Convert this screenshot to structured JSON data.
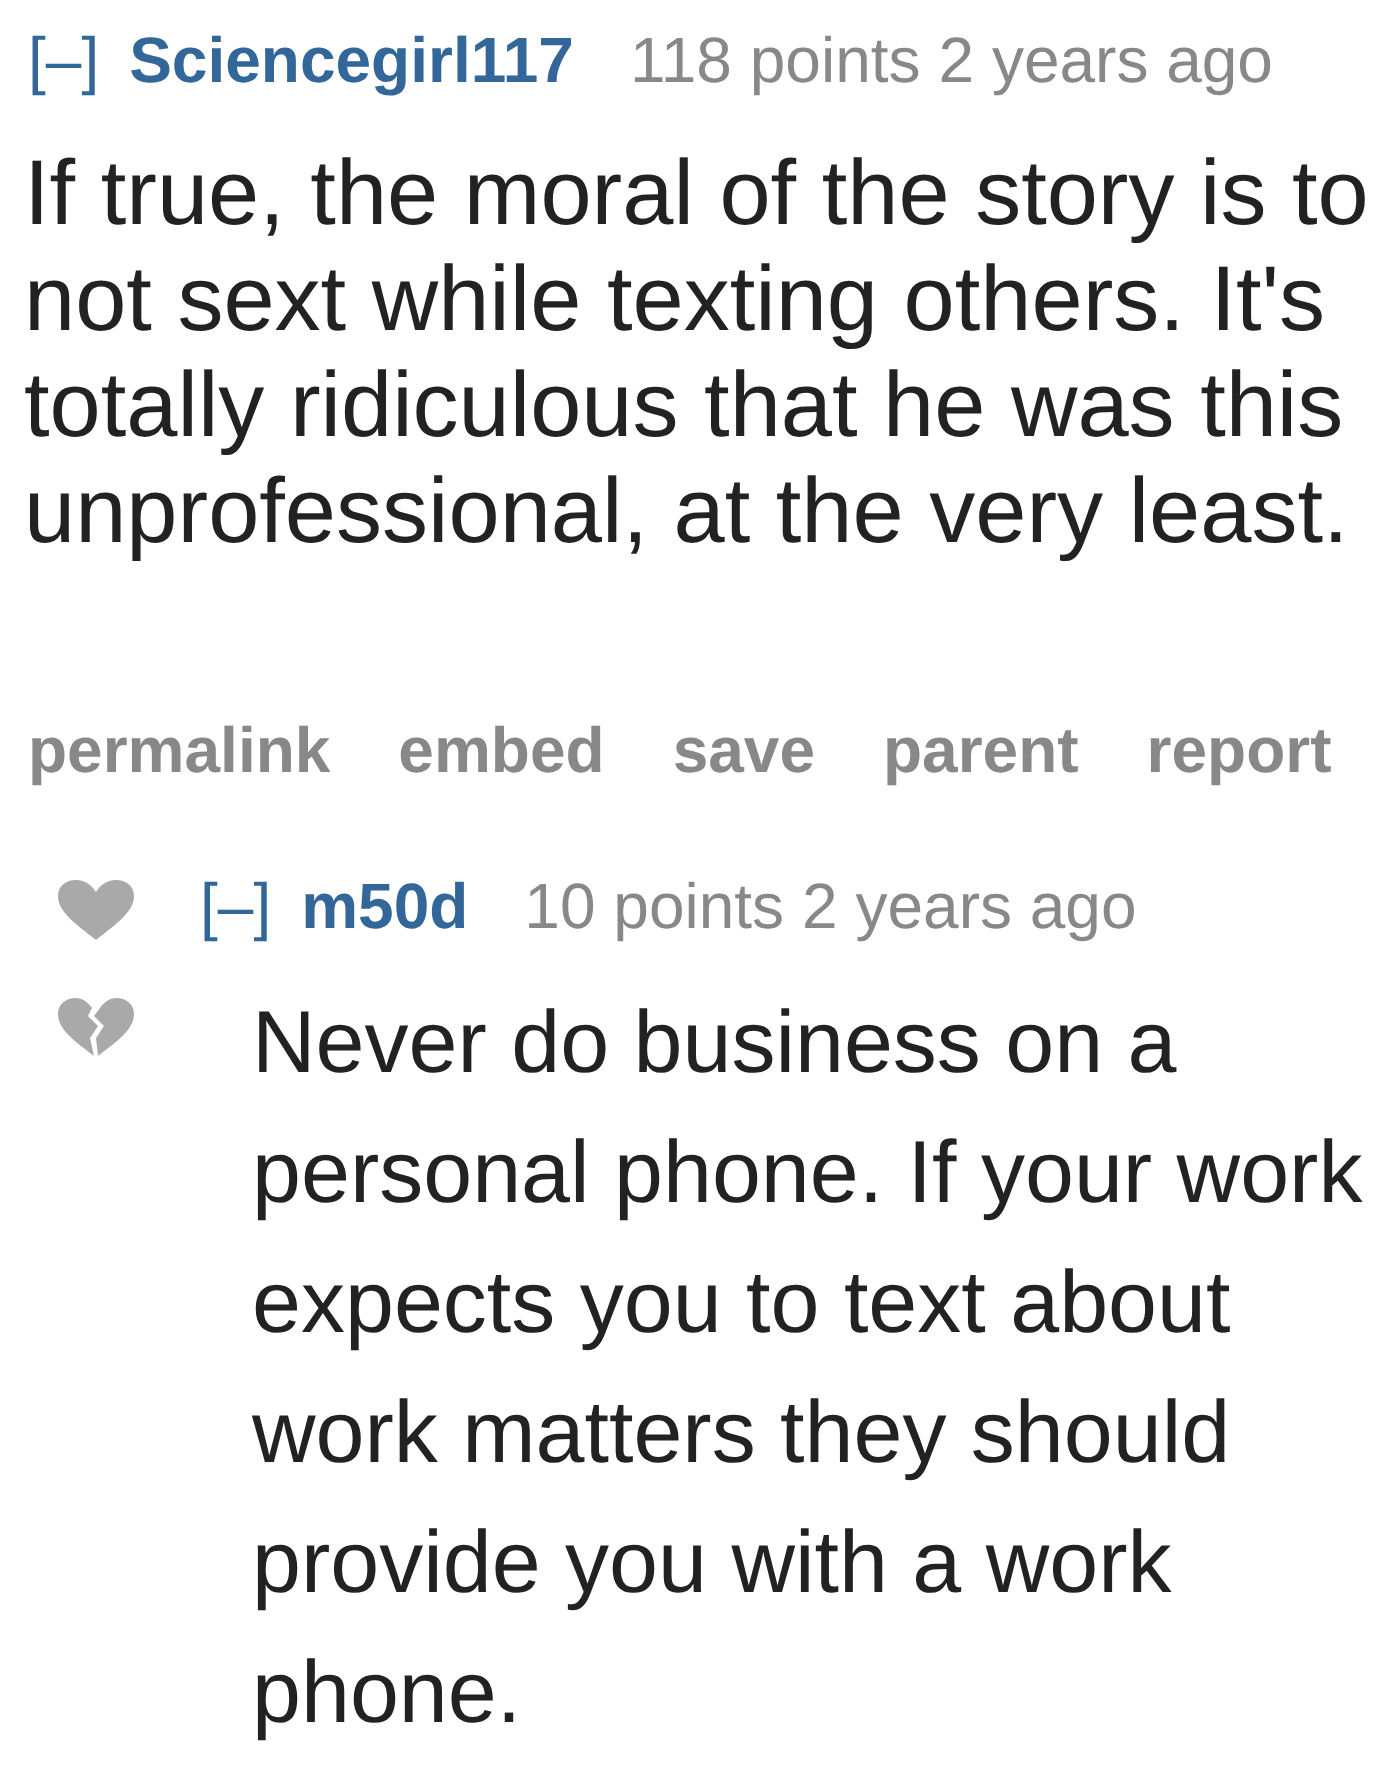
{
  "comments": [
    {
      "kind": "top",
      "collapse_toggle": "[–]",
      "author": "Sciencegirl117",
      "score": "118 points",
      "time": "2 years ago",
      "body": "If true, the moral of the story is to not sext while texting others. It's totally ridiculous that he was this unprofessional, at the very least.",
      "actions": [
        "permalink",
        "embed",
        "save",
        "parent",
        "report"
      ]
    },
    {
      "kind": "reply",
      "collapse_toggle": "[–]",
      "author": "m50d",
      "score": "10 points",
      "time": "2 years ago",
      "body": "Never do business on a personal phone. If your work expects you to text about work matters they should provide you with a work phone."
    }
  ]
}
